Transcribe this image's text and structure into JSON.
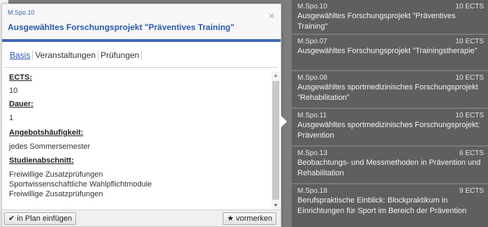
{
  "panel": {
    "code": "M.Spo.10",
    "title": "Ausgewähltes Forschungsprojekt \"Präventives Training\"",
    "close_icon": "×",
    "tabs": [
      {
        "label": "Basis",
        "active": true
      },
      {
        "label": "Veranstaltungen",
        "active": false
      },
      {
        "label": "Prüfungen",
        "active": false
      }
    ],
    "details": {
      "ects_label": "ECTS:",
      "ects_value": "10",
      "duration_label": "Dauer:",
      "duration_value": "1",
      "frequency_label": "Angebotshäufigkeit:",
      "frequency_value": "jedes Sommersemester",
      "section_label": "Studienabschnitt:",
      "section_values": [
        "Freiwillige Zusatzprüfungen",
        "Sportwissenschaftliche Wahlpflichtmodule",
        "Freiwillige Zusatzprüfungen"
      ]
    },
    "footer": {
      "add_icon": "✔",
      "add_label": "in Plan einfügen",
      "mark_icon": "★",
      "mark_label": "vormerken"
    },
    "scroll_up": "▲",
    "scroll_down": "▼"
  },
  "modules": [
    {
      "code": "M.Spo.10",
      "ects": "10 ECTS",
      "title": "Ausgewähltes Forschungsprojekt \"Präventives Training\""
    },
    {
      "code": "M.Spo.07",
      "ects": "10 ECTS",
      "title": "Ausgewähltes Forschungsprojekt \"Trainingstherapie\""
    },
    {
      "code": "M.Spo.08",
      "ects": "10 ECTS",
      "title": "Ausgewähltes sportmedizinisches Forschungsprojekt \"Rehabilitation\""
    },
    {
      "code": "M.Spo.11",
      "ects": "10 ECTS",
      "title": "Ausgewähltes sportmedizinisches Forschungsprojekt: Prävention"
    },
    {
      "code": "M.Spo.13",
      "ects": "6 ECTS",
      "title": "Beobachtungs- und Messmethoden in Prävention und Rehabilitation"
    },
    {
      "code": "M.Spo.18",
      "ects": "9 ECTS",
      "title": "Berufspraktische Einblick: Blockpraktikum in Einrichtungen für Sport im Bereich der Prävention"
    }
  ]
}
